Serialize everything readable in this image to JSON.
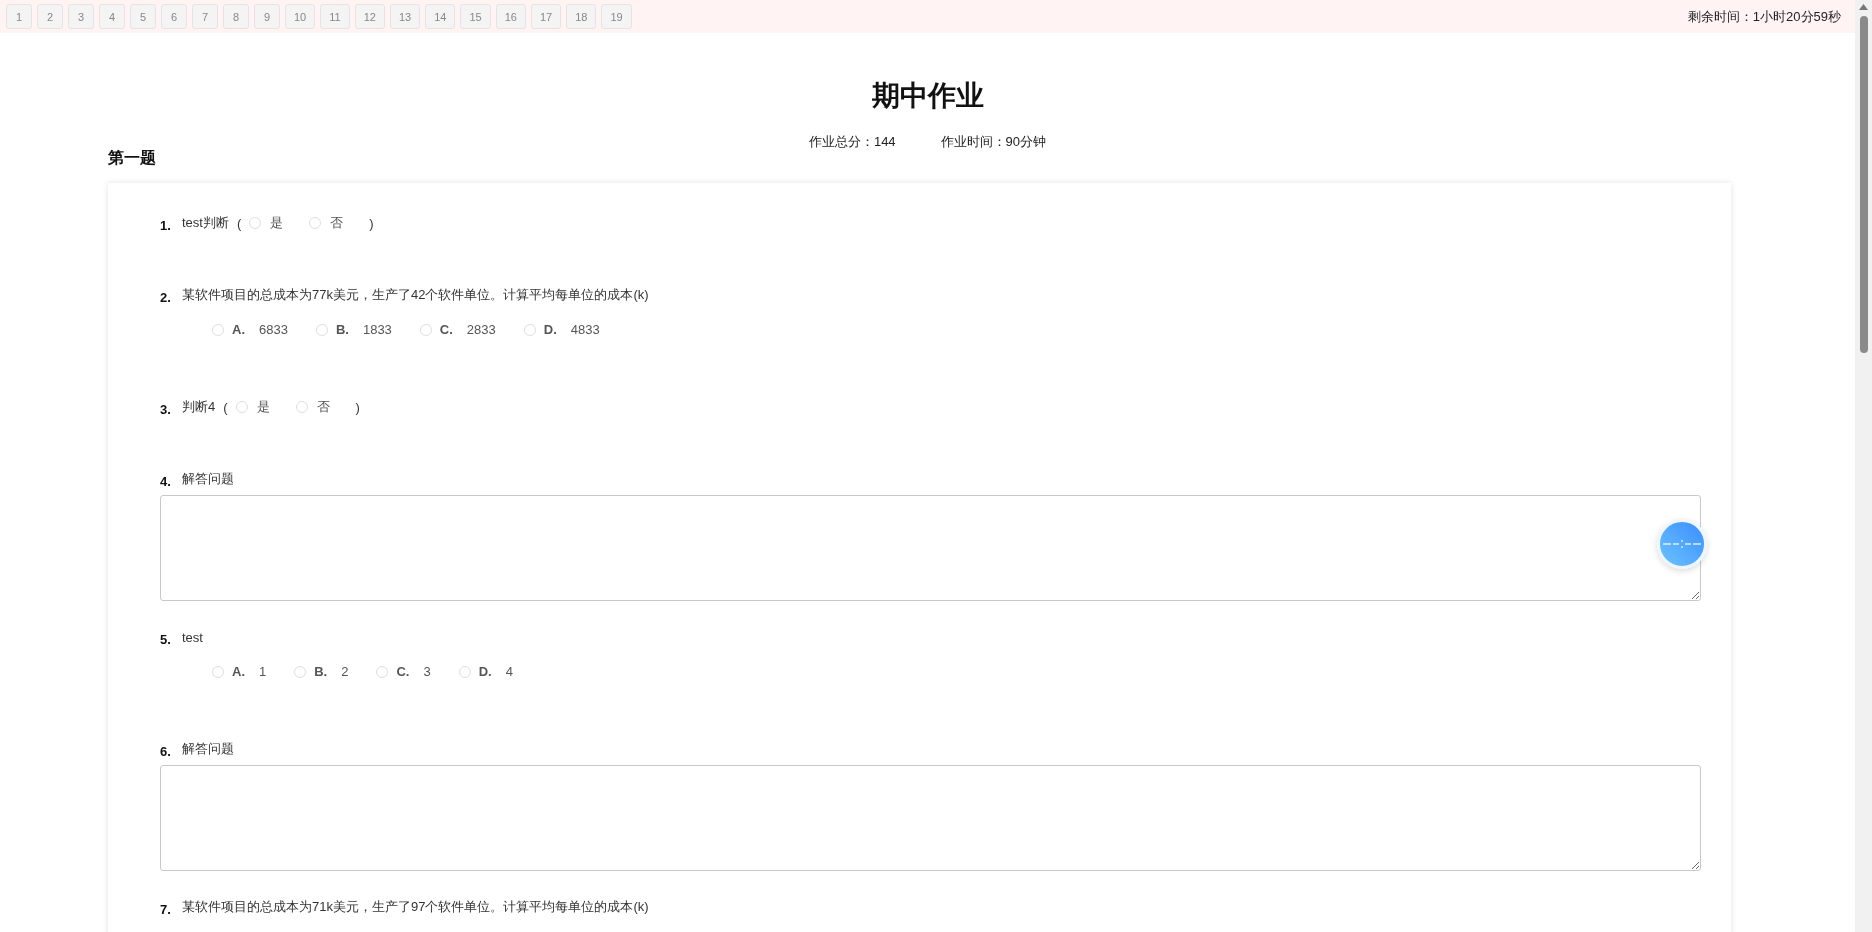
{
  "nav": {
    "buttons": [
      "1",
      "2",
      "3",
      "4",
      "5",
      "6",
      "7",
      "8",
      "9",
      "10",
      "11",
      "12",
      "13",
      "14",
      "15",
      "16",
      "17",
      "18",
      "19"
    ]
  },
  "timer": "剩余时间：1小时20分59秒",
  "title": "期中作业",
  "meta": [
    "作业总分：144",
    "作业时间：90分钟"
  ],
  "section": "第一题",
  "questions": [
    {
      "number": "1.",
      "kind": "judge",
      "text": "test判断",
      "open": "(",
      "close": ")",
      "options": [
        {
          "text": "是",
          "selected": false
        },
        {
          "text": "否",
          "selected": false
        }
      ]
    },
    {
      "number": "2.",
      "kind": "choice",
      "text": "某软件项目的总成本为77k美元，生产了42个软件单位。计算平均每单位的成本(k)",
      "options": [
        {
          "letter": "A.",
          "text": "6833",
          "selected": false
        },
        {
          "letter": "B.",
          "text": "1833",
          "selected": false
        },
        {
          "letter": "C.",
          "text": "2833",
          "selected": false
        },
        {
          "letter": "D.",
          "text": "4833",
          "selected": false
        }
      ]
    },
    {
      "number": "3.",
      "kind": "judge",
      "text": "判断4",
      "open": "(",
      "close": ")",
      "options": [
        {
          "text": "是",
          "selected": false
        },
        {
          "text": "否",
          "selected": false
        }
      ]
    },
    {
      "number": "4.",
      "kind": "essay",
      "text": "解答问题"
    },
    {
      "number": "5.",
      "kind": "choice",
      "text": "test",
      "options": [
        {
          "letter": "A.",
          "text": "1",
          "selected": false
        },
        {
          "letter": "B.",
          "text": "2",
          "selected": false
        },
        {
          "letter": "C.",
          "text": "3",
          "selected": false
        },
        {
          "letter": "D.",
          "text": "4",
          "selected": false
        }
      ]
    },
    {
      "number": "6.",
      "kind": "essay",
      "text": "解答问题"
    },
    {
      "number": "7.",
      "kind": "text",
      "text": "某软件项目的总成本为71k美元，生产了97个软件单位。计算平均每单位的成本(k)"
    }
  ]
}
